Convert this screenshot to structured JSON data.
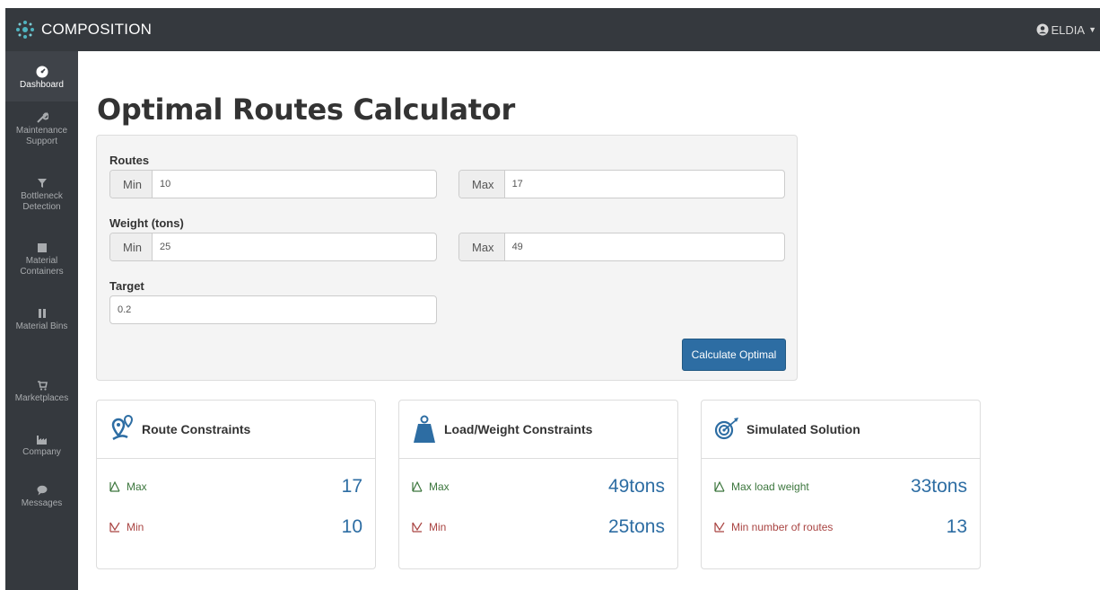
{
  "app": {
    "brand": "COMPOSITION",
    "user": "ELDIA"
  },
  "sidebar": {
    "items": [
      {
        "label": "Dashboard",
        "icon": "dashboard-icon",
        "active": true
      },
      {
        "label": "Maintenance Support",
        "icon": "wrench-icon"
      },
      {
        "label": "Bottleneck Detection",
        "icon": "filter-icon"
      },
      {
        "label": "Material Containers",
        "icon": "container-icon"
      },
      {
        "label": "Material Bins",
        "icon": "bins-icon"
      },
      {
        "label": "Marketplaces",
        "icon": "cart-icon"
      },
      {
        "label": "Company",
        "icon": "factory-icon"
      },
      {
        "label": "Messages",
        "icon": "chat-icon"
      }
    ]
  },
  "page": {
    "title": "Optimal Routes Calculator"
  },
  "form": {
    "routes": {
      "label": "Routes",
      "min_addon": "Min",
      "min_value": "10",
      "max_addon": "Max",
      "max_value": "17"
    },
    "weight": {
      "label": "Weight (tons)",
      "min_addon": "Min",
      "min_value": "25",
      "max_addon": "Max",
      "max_value": "49"
    },
    "target": {
      "label": "Target",
      "value": "0.2"
    },
    "calculate_label": "Calculate Optimal"
  },
  "cards": {
    "route": {
      "title": "Route Constraints",
      "icon": "route-pin-icon",
      "max_label": "Max",
      "max_value": "17",
      "min_label": "Min",
      "min_value": "10"
    },
    "load": {
      "title": "Load/Weight Constraints",
      "icon": "weight-icon",
      "max_label": "Max",
      "max_value": "49tons",
      "min_label": "Min",
      "min_value": "25tons"
    },
    "solution": {
      "title": "Simulated Solution",
      "icon": "target-icon",
      "max_label": "Max load weight",
      "max_value": "33tons",
      "min_label": "Min number of routes",
      "min_value": "13"
    }
  },
  "colors": {
    "navbar": "#35393e",
    "accent": "#2d6da3",
    "max": "#3c763d",
    "min": "#a94442"
  }
}
